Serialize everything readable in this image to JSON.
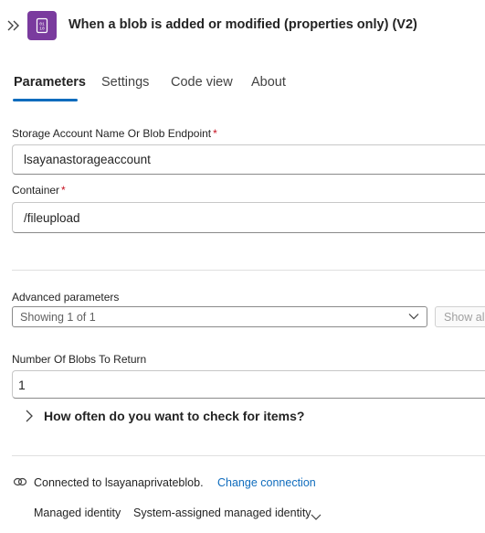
{
  "header": {
    "collapse_icon": "chevron-double-right-icon",
    "app_icon": "storage-blob-icon",
    "app_color": "#7a3b9e",
    "title": "When a blob is added or modified (properties only) (V2)"
  },
  "tabs": [
    {
      "label": "Parameters",
      "active": true
    },
    {
      "label": "Settings",
      "active": false
    },
    {
      "label": "Code view",
      "active": false
    },
    {
      "label": "About",
      "active": false
    }
  ],
  "accent_color": "#0f6cbd",
  "required_color": "#c50f1f",
  "fields": {
    "storage_account": {
      "label": "Storage Account Name Or Blob Endpoint",
      "required_mark": "*",
      "value": "lsayanastorageaccount"
    },
    "container": {
      "label": "Container",
      "required_mark": "*",
      "value": "/fileupload"
    },
    "number_of_blobs": {
      "label": "Number Of Blobs To Return",
      "value": "1"
    }
  },
  "advanced": {
    "label": "Advanced parameters",
    "select_value": "Showing 1 of 1",
    "show_all_label": "Show all"
  },
  "polling": {
    "label": "How often do you want to check for items?",
    "expand_icon": "chevron-right-icon"
  },
  "connection": {
    "icon": "link-icon",
    "text": "Connected to lsayanaprivateblob.",
    "change_label": "Change connection",
    "identity_label": "Managed identity",
    "identity_value": "System-assigned managed identity",
    "identity_icon": "chevron-down-icon"
  }
}
